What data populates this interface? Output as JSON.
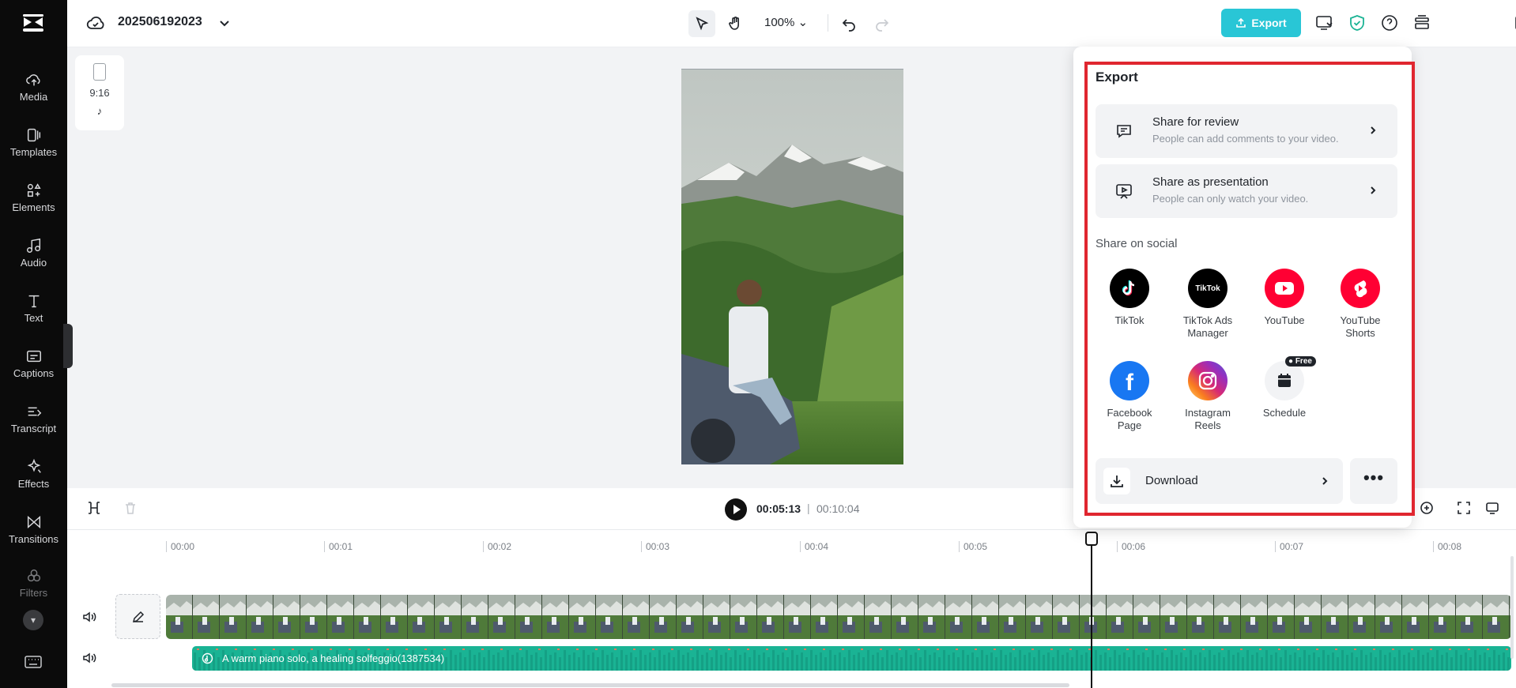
{
  "sidebar": {
    "items": [
      {
        "label": "Media",
        "icon": "cloud-upload-icon"
      },
      {
        "label": "Templates",
        "icon": "templates-icon"
      },
      {
        "label": "Elements",
        "icon": "elements-icon"
      },
      {
        "label": "Audio",
        "icon": "music-note-icon"
      },
      {
        "label": "Text",
        "icon": "text-icon"
      },
      {
        "label": "Captions",
        "icon": "captions-icon"
      },
      {
        "label": "Transcript",
        "icon": "transcript-icon"
      },
      {
        "label": "Effects",
        "icon": "effects-icon"
      },
      {
        "label": "Transitions",
        "icon": "transitions-icon"
      },
      {
        "label": "Filters",
        "icon": "filters-icon"
      }
    ]
  },
  "topbar": {
    "project_name": "202506192023",
    "zoom": "100%",
    "export_label": "Export"
  },
  "canvas": {
    "aspect_ratio": "9:16"
  },
  "player": {
    "current_time": "00:05:13",
    "separator": "|",
    "total_time": "00:10:04"
  },
  "timeline": {
    "ticks": [
      "00:00",
      "00:01",
      "00:02",
      "00:03",
      "00:04",
      "00:05",
      "00:06",
      "00:07",
      "00:08"
    ],
    "audio_clip_label": "A warm piano solo, a healing solfeggio(1387534)"
  },
  "export_panel": {
    "title": "Export",
    "share_review": {
      "title": "Share for review",
      "subtitle": "People can add comments to your video."
    },
    "share_presentation": {
      "title": "Share as presentation",
      "subtitle": "People can only watch your video."
    },
    "social_header": "Share on social",
    "social": [
      {
        "name": "TikTok",
        "color": "#000000"
      },
      {
        "name": "TikTok Ads Manager",
        "color": "#000000",
        "logo_text": "TikTok"
      },
      {
        "name": "YouTube",
        "color": "#ff0033"
      },
      {
        "name": "YouTube Shorts",
        "color": "#ff0033"
      },
      {
        "name": "Facebook Page",
        "color": "#1877f2"
      },
      {
        "name": "Instagram Reels",
        "color": "#e1306c"
      },
      {
        "name": "Schedule",
        "color": "#f2f3f5",
        "badge": "Free"
      }
    ],
    "download_label": "Download",
    "more_label": "•••"
  },
  "colors": {
    "accent": "#29c6d6",
    "highlight_frame": "#e0262f",
    "audio_track": "#1ab394"
  }
}
